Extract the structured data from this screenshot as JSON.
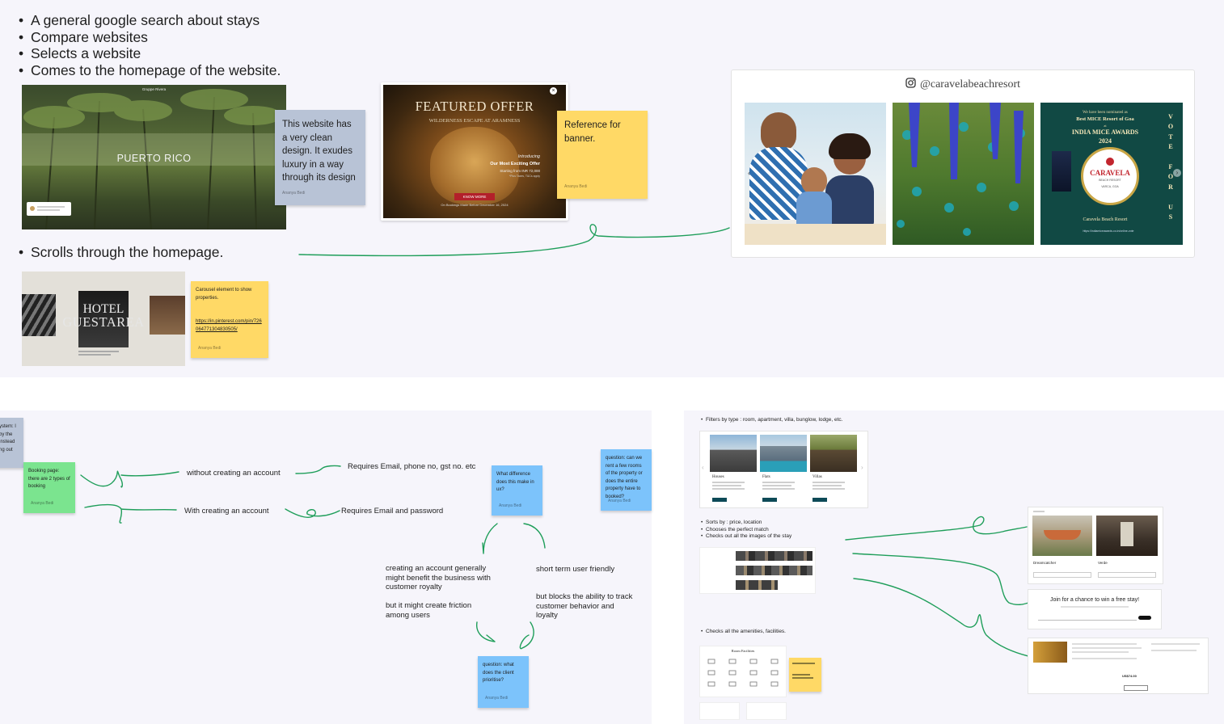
{
  "research": {
    "bullets": [
      "A general google search about stays",
      "Compare websites",
      "Selects a website",
      "Comes to the homepage of the website."
    ],
    "scroll_bullet": "Scrolls through the homepage."
  },
  "puerto": {
    "title": "PUERTO RICO",
    "top_label": "Gruppe Rivera"
  },
  "note_clean": {
    "text": "This website has a very clean design. It exudes luxury in a way through its design",
    "author": "Ananya Bedi"
  },
  "featured": {
    "title": "FEATURED OFFER",
    "subtitle": "WILDERNESS ESCAPE AT ARAMNESS",
    "intro": "Introducing",
    "offer": "Our Most Exciting Offer",
    "price": "Starting from INR 72,000",
    "tax": "*Plus Taxes, T&Cs apply",
    "cta": "KNOW MORE",
    "footer": "On Bookings Made Before December 16, 2024"
  },
  "note_banner": {
    "text": "Reference for banner.",
    "author": "Ananya Bedi"
  },
  "instagram": {
    "handle": "@caravelabeachresort",
    "award": {
      "line1": "We have been nominated as",
      "line2": "Best MICE Resort of Goa",
      "line3": "at",
      "event": "INDIA MICE AWARDS",
      "year": "2024",
      "badge": "CARAVELA",
      "badge_sub": "BEACH RESORT",
      "badge_loc": "VARCA, GOA",
      "foot": "Caravela Beach Resort",
      "link": "https://indiamiceawards.co.in/online-vote",
      "vertical": [
        "V",
        "O",
        "T",
        "E",
        "",
        "F",
        "O",
        "R",
        "",
        "U",
        "S"
      ]
    }
  },
  "hotel": {
    "line1": "HOTEL",
    "line2": "GUESTAREA"
  },
  "note_carousel": {
    "text": "Carousel element to show properties.",
    "link": "https://in.pinterest.com/pin/726064771304830505/",
    "author": "Ananya Bedi"
  },
  "booking": {
    "partial": "ystem: l by the instead ng out",
    "sticky": {
      "text": "Booking page: there are 2 types of booking",
      "author": "Ananya Bedi"
    },
    "without": "without creating an account",
    "with": "With creating an account",
    "req_without": "Requires Email, phone no, gst no. etc",
    "req_with": "Requires Email and password",
    "q_difference": {
      "text": "What difference does this make in ux?",
      "author": "Ananya Bedi"
    },
    "q_rooms": {
      "text": "question: can we rent a few rooms of the property or does the entire property have to booked?",
      "author": "Ananya Bedi"
    },
    "benefit": "creating an account generally\nmight benefit the business with\ncustomer royalty",
    "friction": "but it might create friction\namong users",
    "short_term": "short term user friendly",
    "blocks": "but blocks the ability to track\ncustomer behavior and\nloyalty",
    "q_prioritise": {
      "text": "question: what does the client prioritise?",
      "author": "Ananya Bedi"
    }
  },
  "filters": {
    "filter_bullet": "Filters by type : room, apartment, villa, bunglow, lodge, etc.",
    "types": [
      "Houses",
      "Flats",
      "Villas"
    ],
    "sort_bullets": [
      "Sorts by : price, location",
      "Chooses the perfect match",
      "Checks out all the images of the stay"
    ],
    "amenities_bullet": "Checks all the amenities, facilities.",
    "room_facilities": "Room Facilities",
    "join": "Join for a chance to win a free stay!",
    "stay_names": [
      "Dreamcatcher",
      "Verde"
    ],
    "price": "US$74.00",
    "colors": {
      "teal": "#0d4a57"
    }
  },
  "colors": {
    "green_line": "#1f9e5a",
    "blue": "#7cc3fb",
    "yellow": "#ffd966",
    "green": "#7be48f",
    "gray": "#b8c3d6",
    "canvas": "#f6f5fb"
  }
}
